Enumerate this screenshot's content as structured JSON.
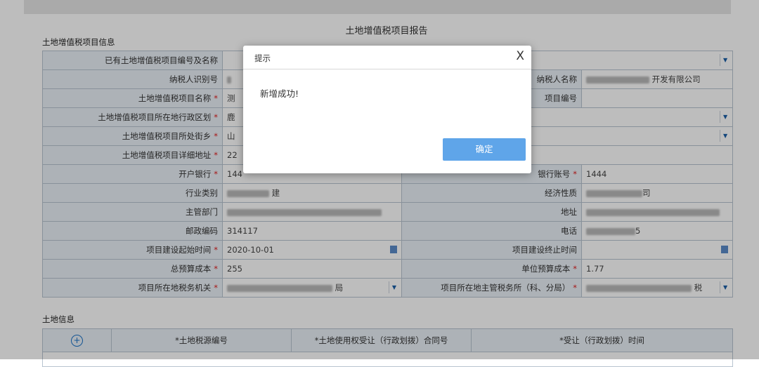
{
  "page": {
    "title": "土地增值税项目报告"
  },
  "sections": {
    "project_info": "土地增值税项目信息",
    "land_info": "土地信息"
  },
  "form": {
    "existing_project": {
      "label": "已有土地增值税项目编号及名称"
    },
    "taxpayer_id": {
      "label": "纳税人识别号",
      "right_label": "纳税人名称",
      "right_value": "开发有限公司"
    },
    "project_name": {
      "label": "土地增值税项目名称",
      "value": "测",
      "right_label": "项目编号"
    },
    "admin_region": {
      "label": "土地增值税项目所在地行政区划",
      "value": "鹿"
    },
    "street": {
      "label": "土地增值税项目所处街乡",
      "value": "山"
    },
    "address": {
      "label": "土地增值税项目详细地址",
      "value": "22"
    },
    "bank": {
      "label": "开户银行",
      "value": "144",
      "right_label": "银行账号",
      "right_value": "1444"
    },
    "industry": {
      "label": "行业类别",
      "value": "建",
      "right_label": "经济性质",
      "right_value": "司"
    },
    "authority": {
      "label": "主管部门",
      "right_label": "地址"
    },
    "postal": {
      "label": "邮政编码",
      "value": "314117",
      "right_label": "电话",
      "right_value": "5"
    },
    "start_time": {
      "label": "项目建设起始时间",
      "value": "2020-10-01",
      "right_label": "项目建设终止时间"
    },
    "budget": {
      "label": "总预算成本",
      "value": "255",
      "right_label": "单位预算成本",
      "right_value": "1.77"
    },
    "tax_office": {
      "label": "项目所在地税务机关",
      "value": "局",
      "right_label": "项目所在地主管税务所（科、分局）",
      "right_value": "税"
    }
  },
  "land": {
    "headers": [
      "*土地税源编号",
      "*土地使用权受让（行政划拨）合同号",
      "*受让（行政划拨）时间"
    ]
  },
  "dialog": {
    "title": "提示",
    "close": "X",
    "message": "新增成功!",
    "ok": "确定"
  },
  "colors": {
    "label_bg": "#eaf0f7",
    "border": "#b8c4d0",
    "required": "#e02020",
    "ok_button": "#5fa5e9"
  }
}
